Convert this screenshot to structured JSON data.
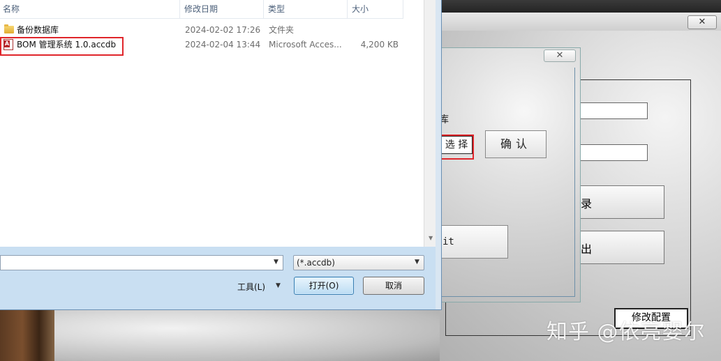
{
  "file_dialog": {
    "columns": {
      "name": "名称",
      "date": "修改日期",
      "type": "类型",
      "size": "大小"
    },
    "rows": [
      {
        "name": "备份数据库",
        "date": "2024-02-02 17:26",
        "type": "文件夹",
        "size": "",
        "icon": "folder-icon"
      },
      {
        "name": "BOM 管理系统 1.0.accdb",
        "date": "2024-02-04 13:44",
        "type": "Microsoft Acces...",
        "size": "4,200 KB",
        "icon": "access-file-icon"
      }
    ],
    "filename_value": "",
    "filter_value": "(*.accdb)",
    "tools_label": "工具(L)",
    "open_label": "打开(O)",
    "cancel_label": "取消"
  },
  "mid_dialog": {
    "close_glyph": "✕",
    "label_char": "库",
    "select_label": "选 择",
    "confirm_label": "确认",
    "exit_label": "it"
  },
  "main_window": {
    "close_glyph": "✕",
    "login_label": "录",
    "exit_label": "出",
    "config_label": "修改配置"
  },
  "watermark": "知乎 @依亮婴尔",
  "colors": {
    "highlight": "#e0262b",
    "open_button_border": "#3c7fb1"
  }
}
